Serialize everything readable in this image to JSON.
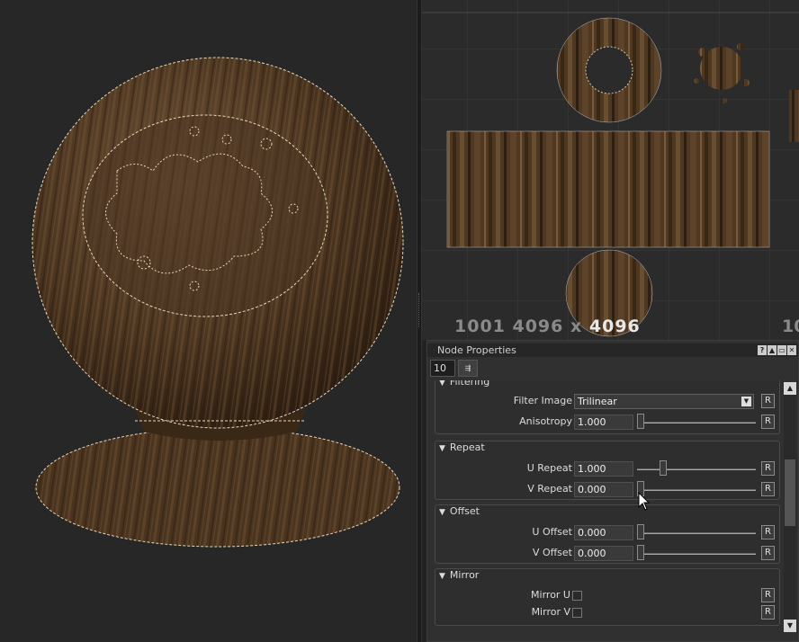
{
  "uv_view": {
    "tile_label": "1001 4096 x",
    "tile_size_highlight": "4096",
    "next_tile_label": "10"
  },
  "node_properties": {
    "title": "Node Properties",
    "header_buttons": [
      "?",
      "▲",
      "▭",
      "✕"
    ],
    "count_value": "10",
    "small_button_label": "⇶",
    "groups": {
      "filtering": {
        "title": "Filtering",
        "filter_image_label": "Filter Image",
        "filter_image_value": "Trilinear",
        "anisotropy_label": "Anisotropy",
        "anisotropy_value": "1.000",
        "anisotropy_level": 0.0
      },
      "repeat": {
        "title": "Repeat",
        "u_label": "U Repeat",
        "u_value": "1.000",
        "u_level": 0.2,
        "v_label": "V Repeat",
        "v_value": "0.000",
        "v_level": 0.0
      },
      "offset": {
        "title": "Offset",
        "u_label": "U Offset",
        "u_value": "0.000",
        "v_label": "V Offset",
        "v_value": "0.000"
      },
      "mirror": {
        "title": "Mirror",
        "u_label": "Mirror U",
        "u_checked": false,
        "v_label": "Mirror V",
        "v_checked": false
      }
    },
    "reset_label": "R"
  },
  "colors": {
    "wood_dark": "#3a2a1a",
    "wood_mid": "#5a4128",
    "wood_light": "#7a5c3c",
    "seam": "#e8d8b8"
  }
}
